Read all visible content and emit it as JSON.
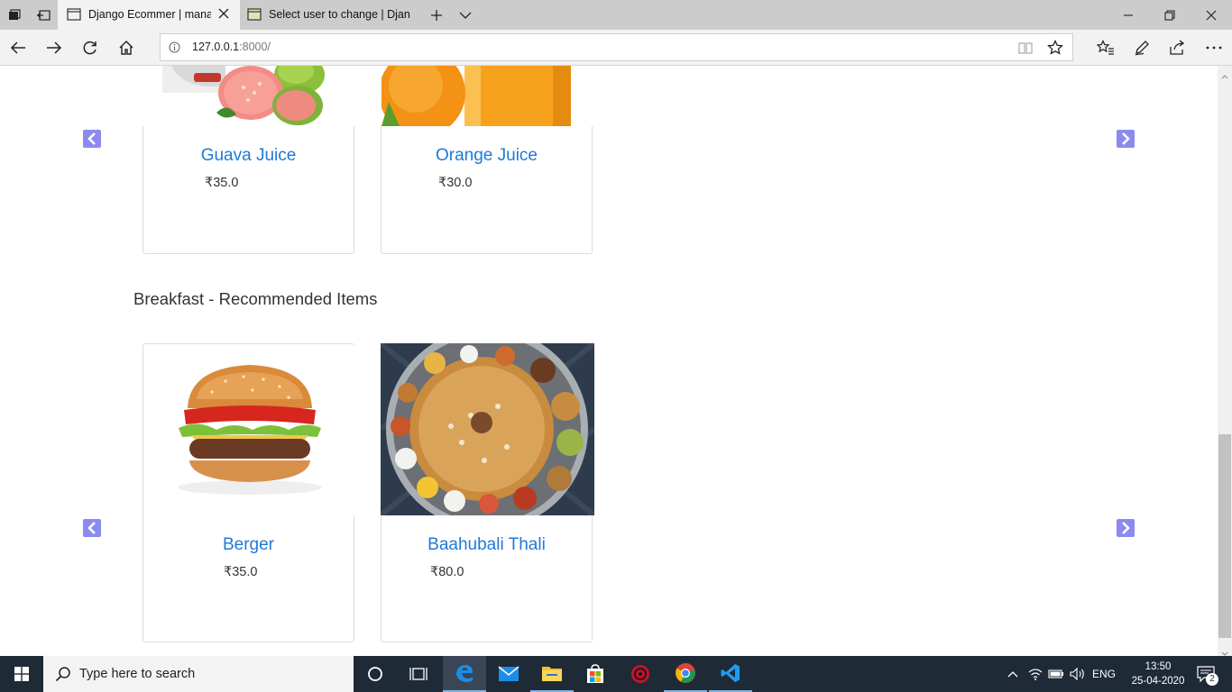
{
  "browser": {
    "tabs": [
      {
        "title": "Django Ecommer | mana",
        "active": true
      },
      {
        "title": "Select user to change | Djan",
        "active": false
      }
    ],
    "address": {
      "host": "127.0.0.1",
      "port_path": ":8000/"
    }
  },
  "page": {
    "top_row": {
      "items": [
        {
          "name": "Guava Juice",
          "price": "₹35.0"
        },
        {
          "name": "Orange Juice",
          "price": "₹30.0"
        }
      ]
    },
    "breakfast": {
      "title": "Breakfast - Recommended Items",
      "items": [
        {
          "name": "Berger",
          "price": "₹35.0"
        },
        {
          "name": "Baahubali Thali",
          "price": "₹80.0"
        }
      ]
    },
    "colors": {
      "link": "#1e7ad8",
      "carousel_arrow": "#8b8bef"
    }
  },
  "taskbar": {
    "search_placeholder": "Type here to search",
    "language": "ENG",
    "time": "13:50",
    "date": "25-04-2020",
    "notification_count": "2"
  }
}
